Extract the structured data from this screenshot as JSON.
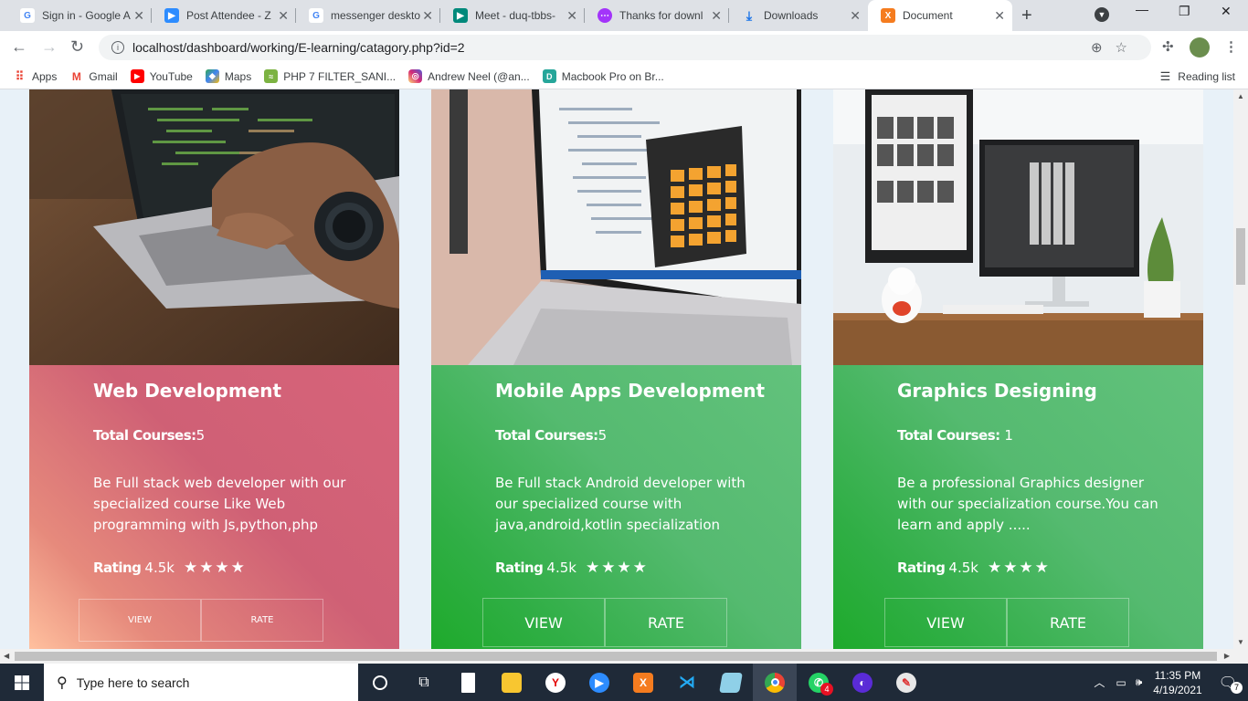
{
  "browser": {
    "tabs": [
      {
        "title": "Sign in - Google A",
        "favicon": "google-g-icon",
        "color": "#4285f4",
        "glyph": "G"
      },
      {
        "title": "Post Attendee - Z",
        "favicon": "zoom-icon",
        "color": "#2d8cff",
        "glyph": "▶"
      },
      {
        "title": "messenger deskto",
        "favicon": "google-g-icon",
        "color": "#4285f4",
        "glyph": "G"
      },
      {
        "title": "Meet - duq-tbbs-",
        "favicon": "meet-icon",
        "color": "#00897b",
        "glyph": "▶"
      },
      {
        "title": "Thanks for downl",
        "favicon": "messenger-icon",
        "color": "#a334fa",
        "glyph": "⋯"
      },
      {
        "title": "Downloads",
        "favicon": "download-icon",
        "color": "#1a73e8",
        "glyph": "↓"
      },
      {
        "title": "Document",
        "favicon": "xampp-icon",
        "color": "#f57c1f",
        "glyph": "X"
      }
    ],
    "active_tab": 6,
    "url": "localhost/dashboard/working/E-learning/catagory.php?id=2",
    "bookmarks": [
      {
        "label": "Apps",
        "icon": "apps-grid-icon",
        "color": "#ea4335"
      },
      {
        "label": "Gmail",
        "icon": "gmail-icon",
        "color": "#ea4335"
      },
      {
        "label": "YouTube",
        "icon": "youtube-icon",
        "color": "#ff0000"
      },
      {
        "label": "Maps",
        "icon": "maps-icon",
        "color": "#34a853"
      },
      {
        "label": "PHP 7 FILTER_SANI...",
        "icon": "php-site-icon",
        "color": "#7cb342"
      },
      {
        "label": "Andrew Neel (@an...",
        "icon": "instagram-icon",
        "color": "#c13584"
      },
      {
        "label": "Macbook Pro on Br...",
        "icon": "site-d-icon",
        "color": "#26a69a"
      }
    ],
    "reading_list": "Reading list"
  },
  "cards": [
    {
      "title": "Web Development",
      "total_label": "Total Courses:",
      "total_value": "5",
      "description": "Be Full stack web developer with our specialized course Like Web programming with Js,python,php",
      "rating_label": "Rating",
      "rating_value": "4.5k",
      "stars": 4,
      "view_label": "VIEW",
      "rate_label": "RATE",
      "theme": "red"
    },
    {
      "title": "Mobile Apps Development",
      "total_label": "Total Courses:",
      "total_value": "5",
      "description": "Be Full stack Android developer with our specialized course with java,android,kotlin specialization",
      "rating_label": "Rating",
      "rating_value": "4.5k",
      "stars": 4,
      "view_label": "VIEW",
      "rate_label": "RATE",
      "theme": "green"
    },
    {
      "title": "Graphics Designing",
      "total_label": "Total Courses:",
      "total_value": " 1",
      "description": "Be a professional Graphics designer with our specialization course.You can learn and apply .....",
      "rating_label": "Rating",
      "rating_value": "4.5k",
      "stars": 4,
      "view_label": "VIEW",
      "rate_label": "RATE",
      "theme": "green"
    }
  ],
  "taskbar": {
    "search_placeholder": "Type here to search",
    "time": "11:35 PM",
    "date": "4/19/2021",
    "notification_count": "7",
    "whatsapp_badge": "4"
  }
}
